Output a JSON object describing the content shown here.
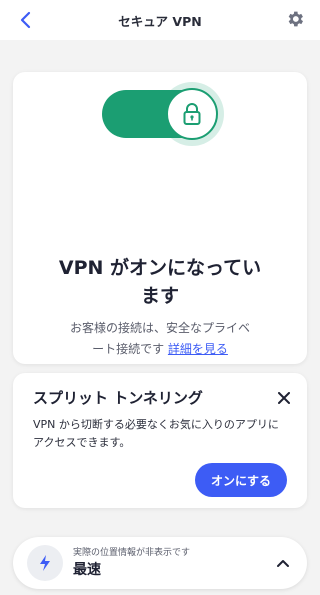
{
  "header": {
    "title": "セキュア VPN"
  },
  "status": {
    "title": "VPN がオンになってい\nます",
    "description": "お客様の接続は、安全なプライベ\nート接続です",
    "details_link": "詳細を見る",
    "vpn_on": true
  },
  "split_tunneling": {
    "title": "スプリット トンネリング",
    "description": "VPN から切断する必要なくお気に入りのアプリに\nアクセスできます。",
    "button_label": "オンにする"
  },
  "location": {
    "subtitle": "実際の位置情報が非表示です",
    "label": "最速"
  },
  "colors": {
    "accent_blue": "#3d5cf5",
    "vpn_green": "#1b9e72",
    "background": "#f3f3f3"
  },
  "icons": {
    "back": "chevron-left-icon",
    "settings": "gear-icon",
    "lock": "lock-icon",
    "close": "close-icon",
    "location": "lightning-icon",
    "expand": "chevron-up-icon"
  }
}
